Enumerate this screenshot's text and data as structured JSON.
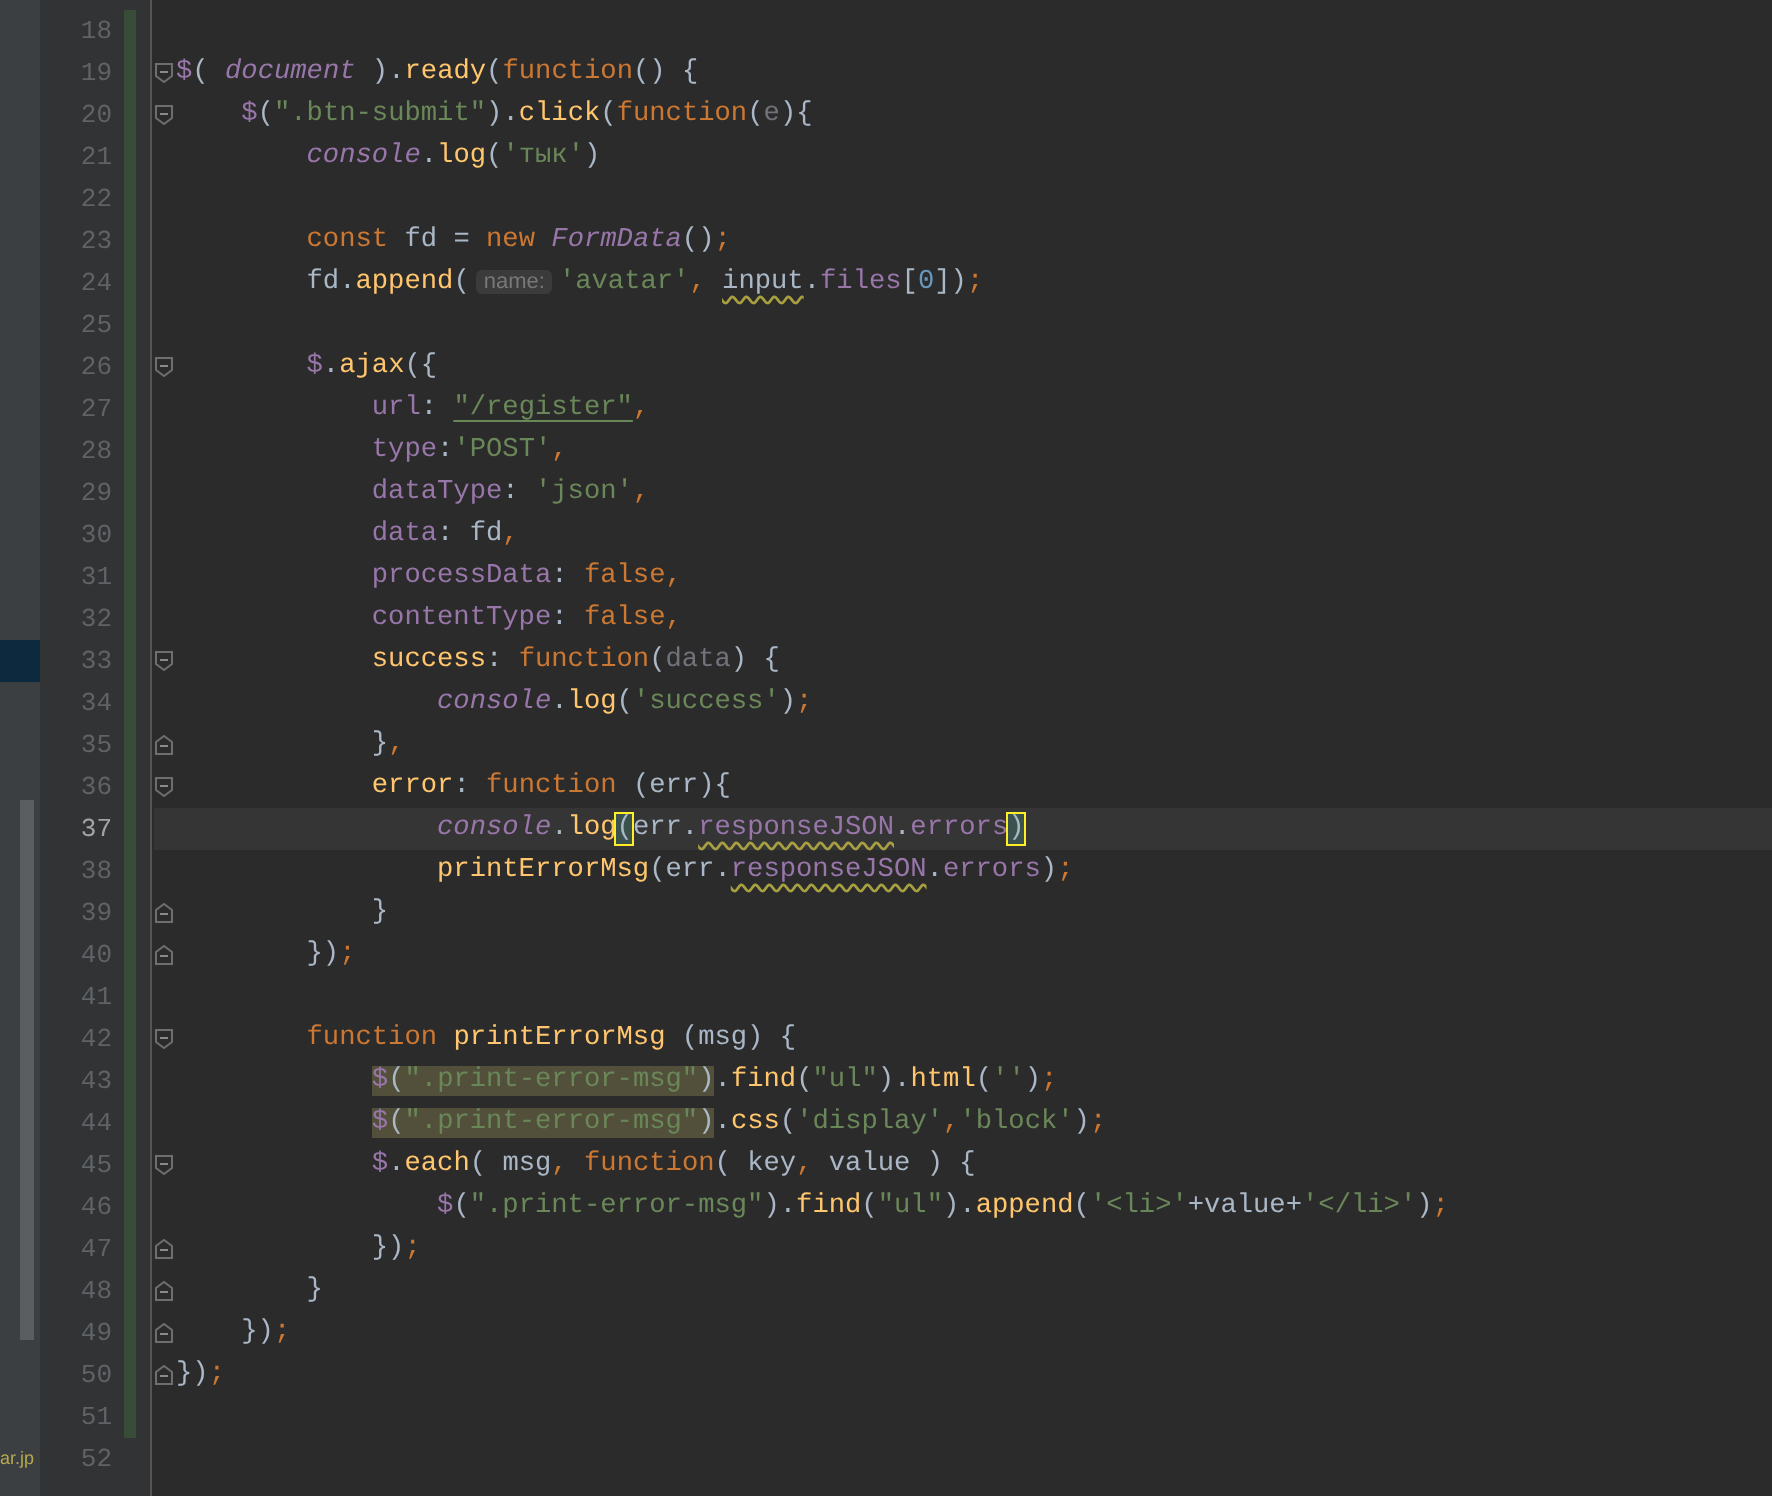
{
  "project_panel": {
    "items": [
      {
        "name": "ar.jp",
        "selected": false
      }
    ]
  },
  "editor": {
    "lines": [
      {
        "number": "18",
        "changed": true,
        "current": false,
        "tree_row_selected": false
      },
      {
        "number": "19",
        "changed": true,
        "current": false,
        "tree_row_selected": false,
        "fold_marker": {
          "kind": "open"
        },
        "tokens": [
          {
            "t": "$",
            "kind": "property"
          },
          {
            "t": "( ",
            "kind": "plain"
          },
          {
            "t": "document",
            "kind": "global"
          },
          {
            "t": " ).",
            "kind": "plain"
          },
          {
            "t": "ready",
            "kind": "method"
          },
          {
            "t": "(",
            "kind": "plain"
          },
          {
            "t": "function",
            "kind": "keyword"
          },
          {
            "t": "() {",
            "kind": "plain"
          }
        ]
      },
      {
        "number": "20",
        "changed": true,
        "current": false,
        "tree_row_selected": false,
        "fold_marker": {
          "kind": "open"
        },
        "tokens": [
          {
            "t": "    $",
            "kind": "property"
          },
          {
            "t": "(",
            "kind": "plain"
          },
          {
            "t": "\".btn-submit\"",
            "kind": "string"
          },
          {
            "t": ").",
            "kind": "plain"
          },
          {
            "t": "click",
            "kind": "method"
          },
          {
            "t": "(",
            "kind": "plain"
          },
          {
            "t": "function",
            "kind": "keyword"
          },
          {
            "t": "(",
            "kind": "plain"
          },
          {
            "t": "e",
            "kind": "unused"
          },
          {
            "t": "){",
            "kind": "plain"
          }
        ]
      },
      {
        "number": "21",
        "changed": true,
        "current": false,
        "tree_row_selected": false,
        "tokens": [
          {
            "t": "        console",
            "kind": "global"
          },
          {
            "t": ".",
            "kind": "plain"
          },
          {
            "t": "log",
            "kind": "method"
          },
          {
            "t": "(",
            "kind": "plain"
          },
          {
            "t": "'тык'",
            "kind": "string"
          },
          {
            "t": ")",
            "kind": "plain"
          }
        ]
      },
      {
        "number": "22",
        "changed": true,
        "current": false,
        "tree_row_selected": false
      },
      {
        "number": "23",
        "changed": true,
        "current": false,
        "tree_row_selected": false,
        "tokens": [
          {
            "t": "        const",
            "kind": "keyword"
          },
          {
            "t": " fd = ",
            "kind": "plain"
          },
          {
            "t": "new ",
            "kind": "keyword"
          },
          {
            "t": "FormData",
            "kind": "global"
          },
          {
            "t": "()",
            "kind": "plain"
          },
          {
            "t": ";",
            "kind": "punct"
          }
        ]
      },
      {
        "number": "24",
        "changed": true,
        "current": false,
        "tree_row_selected": false,
        "tokens": [
          {
            "t": "        fd.",
            "kind": "plain"
          },
          {
            "t": "append",
            "kind": "method"
          },
          {
            "t": "(",
            "kind": "plain"
          },
          {
            "t": "name:",
            "kind": "hint"
          },
          {
            "t": "'avatar'",
            "kind": "string"
          },
          {
            "t": ", ",
            "kind": "punct"
          },
          {
            "t": "input",
            "kind": "warning"
          },
          {
            "t": ".",
            "kind": "plain"
          },
          {
            "t": "files",
            "kind": "property"
          },
          {
            "t": "[",
            "kind": "plain"
          },
          {
            "t": "0",
            "kind": "number"
          },
          {
            "t": "])",
            "kind": "plain"
          },
          {
            "t": ";",
            "kind": "punct"
          }
        ]
      },
      {
        "number": "25",
        "changed": true,
        "current": false,
        "tree_row_selected": false
      },
      {
        "number": "26",
        "changed": true,
        "current": false,
        "tree_row_selected": false,
        "fold_marker": {
          "kind": "open"
        },
        "tokens": [
          {
            "t": "        $",
            "kind": "property"
          },
          {
            "t": ".",
            "kind": "plain"
          },
          {
            "t": "ajax",
            "kind": "method"
          },
          {
            "t": "({",
            "kind": "plain"
          }
        ]
      },
      {
        "number": "27",
        "changed": true,
        "current": false,
        "tree_row_selected": false,
        "tokens": [
          {
            "t": "            url",
            "kind": "property"
          },
          {
            "t": ": ",
            "kind": "plain"
          },
          {
            "t": "\"/register\"",
            "kind": "link"
          },
          {
            "t": ",",
            "kind": "punct"
          }
        ]
      },
      {
        "number": "28",
        "changed": true,
        "current": false,
        "tree_row_selected": false,
        "tokens": [
          {
            "t": "            type",
            "kind": "property"
          },
          {
            "t": ":",
            "kind": "plain"
          },
          {
            "t": "'POST'",
            "kind": "string"
          },
          {
            "t": ",",
            "kind": "punct"
          }
        ]
      },
      {
        "number": "29",
        "changed": true,
        "current": false,
        "tree_row_selected": false,
        "tokens": [
          {
            "t": "            dataType",
            "kind": "property"
          },
          {
            "t": ": ",
            "kind": "plain"
          },
          {
            "t": "'json'",
            "kind": "string"
          },
          {
            "t": ",",
            "kind": "punct"
          }
        ]
      },
      {
        "number": "30",
        "changed": true,
        "current": false,
        "tree_row_selected": false,
        "tokens": [
          {
            "t": "            data",
            "kind": "property"
          },
          {
            "t": ": fd",
            "kind": "plain"
          },
          {
            "t": ",",
            "kind": "punct"
          }
        ]
      },
      {
        "number": "31",
        "changed": true,
        "current": false,
        "tree_row_selected": false,
        "tokens": [
          {
            "t": "            processData",
            "kind": "property"
          },
          {
            "t": ": ",
            "kind": "plain"
          },
          {
            "t": "false",
            "kind": "keyword"
          },
          {
            "t": ",",
            "kind": "punct"
          }
        ]
      },
      {
        "number": "32",
        "changed": true,
        "current": false,
        "tree_row_selected": false,
        "tokens": [
          {
            "t": "            contentType",
            "kind": "property"
          },
          {
            "t": ": ",
            "kind": "plain"
          },
          {
            "t": "false",
            "kind": "keyword"
          },
          {
            "t": ",",
            "kind": "punct"
          }
        ]
      },
      {
        "number": "33",
        "changed": true,
        "current": false,
        "tree_row_selected": true,
        "fold_marker": {
          "kind": "open"
        },
        "tokens": [
          {
            "t": "            success",
            "kind": "method"
          },
          {
            "t": ": ",
            "kind": "plain"
          },
          {
            "t": "function",
            "kind": "keyword"
          },
          {
            "t": "(",
            "kind": "plain"
          },
          {
            "t": "data",
            "kind": "unused"
          },
          {
            "t": ") {",
            "kind": "plain"
          }
        ]
      },
      {
        "number": "34",
        "changed": true,
        "current": false,
        "tree_row_selected": false,
        "tokens": [
          {
            "t": "                console",
            "kind": "global"
          },
          {
            "t": ".",
            "kind": "plain"
          },
          {
            "t": "log",
            "kind": "method"
          },
          {
            "t": "(",
            "kind": "plain"
          },
          {
            "t": "'success'",
            "kind": "string"
          },
          {
            "t": ")",
            "kind": "plain"
          },
          {
            "t": ";",
            "kind": "punct"
          }
        ]
      },
      {
        "number": "35",
        "changed": true,
        "current": false,
        "tree_row_selected": false,
        "fold_marker": {
          "kind": "close"
        },
        "tokens": [
          {
            "t": "            }",
            "kind": "plain"
          },
          {
            "t": ",",
            "kind": "punct"
          }
        ]
      },
      {
        "number": "36",
        "changed": true,
        "current": false,
        "tree_row_selected": false,
        "fold_marker": {
          "kind": "open"
        },
        "tokens": [
          {
            "t": "            error",
            "kind": "method"
          },
          {
            "t": ": ",
            "kind": "plain"
          },
          {
            "t": "function",
            "kind": "keyword"
          },
          {
            "t": " (err){",
            "kind": "plain"
          }
        ]
      },
      {
        "number": "37",
        "changed": true,
        "current": true,
        "tree_row_selected": false,
        "tokens": [
          {
            "t": "                console",
            "kind": "global"
          },
          {
            "t": ".",
            "kind": "plain"
          },
          {
            "t": "log",
            "kind": "method"
          },
          {
            "t": "(",
            "kind": "brace"
          },
          {
            "t": "err.",
            "kind": "plain"
          },
          {
            "t": "responseJSON",
            "kind": "warnprop"
          },
          {
            "t": ".",
            "kind": "plain"
          },
          {
            "t": "errors",
            "kind": "property"
          },
          {
            "t": ")",
            "kind": "brace"
          }
        ]
      },
      {
        "number": "38",
        "changed": true,
        "current": false,
        "tree_row_selected": false,
        "tokens": [
          {
            "t": "                printErrorMsg",
            "kind": "method"
          },
          {
            "t": "(err.",
            "kind": "plain"
          },
          {
            "t": "responseJSON",
            "kind": "warnprop"
          },
          {
            "t": ".",
            "kind": "plain"
          },
          {
            "t": "errors",
            "kind": "property"
          },
          {
            "t": ")",
            "kind": "plain"
          },
          {
            "t": ";",
            "kind": "punct"
          }
        ]
      },
      {
        "number": "39",
        "changed": true,
        "current": false,
        "tree_row_selected": false,
        "fold_marker": {
          "kind": "close"
        },
        "tokens": [
          {
            "t": "            }",
            "kind": "plain"
          }
        ]
      },
      {
        "number": "40",
        "changed": true,
        "current": false,
        "tree_row_selected": false,
        "fold_marker": {
          "kind": "close"
        },
        "tokens": [
          {
            "t": "        })",
            "kind": "plain"
          },
          {
            "t": ";",
            "kind": "punct"
          }
        ]
      },
      {
        "number": "41",
        "changed": true,
        "current": false,
        "tree_row_selected": false
      },
      {
        "number": "42",
        "changed": true,
        "current": false,
        "tree_row_selected": false,
        "fold_marker": {
          "kind": "open"
        },
        "tokens": [
          {
            "t": "        function ",
            "kind": "keyword"
          },
          {
            "t": "printErrorMsg",
            "kind": "method"
          },
          {
            "t": " (msg) {",
            "kind": "plain"
          }
        ]
      },
      {
        "number": "43",
        "changed": true,
        "current": false,
        "tree_row_selected": false,
        "tokens": [
          {
            "kind": "occurrence",
            "tokens": [
              {
                "t": "            $",
                "kind": "property"
              },
              {
                "t": "(",
                "kind": "plain"
              },
              {
                "t": "\".print-error-msg\"",
                "kind": "string"
              },
              {
                "t": ")",
                "kind": "plain"
              }
            ]
          },
          {
            "t": ".",
            "kind": "plain"
          },
          {
            "t": "find",
            "kind": "method"
          },
          {
            "t": "(",
            "kind": "plain"
          },
          {
            "t": "\"ul\"",
            "kind": "string"
          },
          {
            "t": ").",
            "kind": "plain"
          },
          {
            "t": "html",
            "kind": "method"
          },
          {
            "t": "(",
            "kind": "plain"
          },
          {
            "t": "''",
            "kind": "string"
          },
          {
            "t": ")",
            "kind": "plain"
          },
          {
            "t": ";",
            "kind": "punct"
          }
        ]
      },
      {
        "number": "44",
        "changed": true,
        "current": false,
        "tree_row_selected": false,
        "tokens": [
          {
            "kind": "occurrence",
            "tokens": [
              {
                "t": "            $",
                "kind": "property"
              },
              {
                "t": "(",
                "kind": "plain"
              },
              {
                "t": "\".print-error-msg\"",
                "kind": "string"
              },
              {
                "t": ")",
                "kind": "plain"
              }
            ]
          },
          {
            "t": ".",
            "kind": "plain"
          },
          {
            "t": "css",
            "kind": "method"
          },
          {
            "t": "(",
            "kind": "plain"
          },
          {
            "t": "'display'",
            "kind": "string"
          },
          {
            "t": ",",
            "kind": "punct"
          },
          {
            "t": "'block'",
            "kind": "string"
          },
          {
            "t": ")",
            "kind": "plain"
          },
          {
            "t": ";",
            "kind": "punct"
          }
        ]
      },
      {
        "number": "45",
        "changed": true,
        "current": false,
        "tree_row_selected": false,
        "fold_marker": {
          "kind": "open"
        },
        "tokens": [
          {
            "t": "            $",
            "kind": "property"
          },
          {
            "t": ".",
            "kind": "plain"
          },
          {
            "t": "each",
            "kind": "method"
          },
          {
            "t": "( msg",
            "kind": "plain"
          },
          {
            "t": ", ",
            "kind": "punct"
          },
          {
            "t": "function",
            "kind": "keyword"
          },
          {
            "t": "( key",
            "kind": "plain"
          },
          {
            "t": ",",
            "kind": "punct"
          },
          {
            "t": " value ) {",
            "kind": "plain"
          }
        ]
      },
      {
        "number": "46",
        "changed": true,
        "current": false,
        "tree_row_selected": false,
        "tokens": [
          {
            "t": "                $",
            "kind": "property"
          },
          {
            "t": "(",
            "kind": "plain"
          },
          {
            "t": "\".print-error-msg\"",
            "kind": "string"
          },
          {
            "t": ").",
            "kind": "plain"
          },
          {
            "t": "find",
            "kind": "method"
          },
          {
            "t": "(",
            "kind": "plain"
          },
          {
            "t": "\"ul\"",
            "kind": "string"
          },
          {
            "t": ").",
            "kind": "plain"
          },
          {
            "t": "append",
            "kind": "method"
          },
          {
            "t": "(",
            "kind": "plain"
          },
          {
            "t": "'<li>'",
            "kind": "string"
          },
          {
            "t": "+value+",
            "kind": "plain"
          },
          {
            "t": "'</li>'",
            "kind": "string"
          },
          {
            "t": ")",
            "kind": "plain"
          },
          {
            "t": ";",
            "kind": "punct"
          }
        ]
      },
      {
        "number": "47",
        "changed": true,
        "current": false,
        "tree_row_selected": false,
        "fold_marker": {
          "kind": "close"
        },
        "tokens": [
          {
            "t": "            })",
            "kind": "plain"
          },
          {
            "t": ";",
            "kind": "punct"
          }
        ]
      },
      {
        "number": "48",
        "changed": true,
        "current": false,
        "tree_row_selected": false,
        "fold_marker": {
          "kind": "close"
        },
        "tokens": [
          {
            "t": "        }",
            "kind": "plain"
          }
        ]
      },
      {
        "number": "49",
        "changed": true,
        "current": false,
        "tree_row_selected": false,
        "fold_marker": {
          "kind": "close"
        },
        "tokens": [
          {
            "t": "    })",
            "kind": "plain"
          },
          {
            "t": ";",
            "kind": "punct"
          }
        ]
      },
      {
        "number": "50",
        "changed": true,
        "current": false,
        "tree_row_selected": false,
        "fold_marker": {
          "kind": "close"
        },
        "tokens": [
          {
            "t": "})",
            "kind": "plain"
          },
          {
            "t": ";",
            "kind": "punct"
          }
        ]
      },
      {
        "number": "51",
        "changed": true,
        "current": false,
        "tree_row_selected": false
      },
      {
        "number": "52",
        "changed": false,
        "current": false,
        "tree_row_selected": false
      }
    ]
  }
}
